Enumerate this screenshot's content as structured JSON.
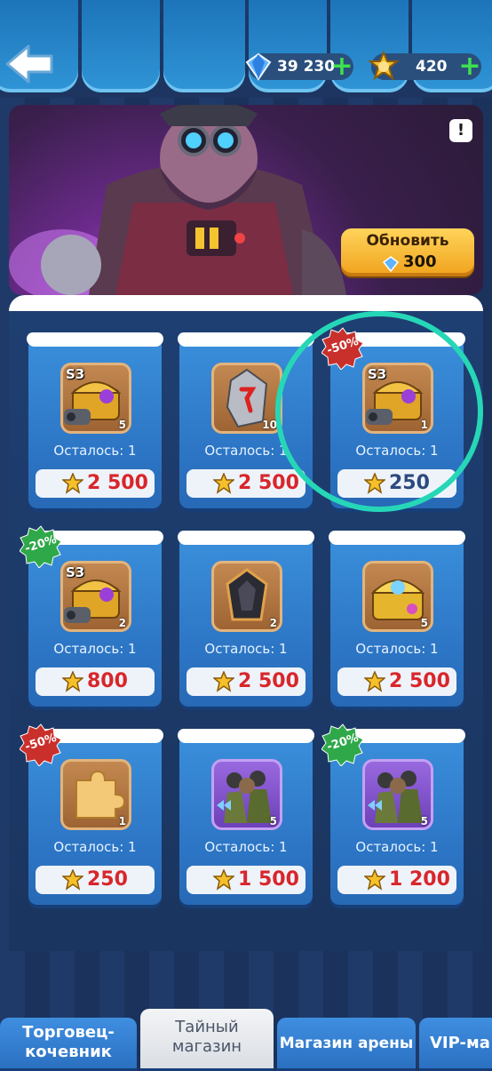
{
  "header": {
    "gems": "39 230",
    "stars": "420"
  },
  "banner": {
    "info_label": "!",
    "refresh_label": "Обновить",
    "refresh_cost": "300"
  },
  "shop": {
    "items": [
      {
        "remaining": "Осталось: 1",
        "price": "2 500",
        "qty": "5",
        "badge": "S3",
        "discount": "",
        "icon": "chest-s3-icon"
      },
      {
        "remaining": "Осталось: 1",
        "price": "2 500",
        "qty": "10",
        "badge": "",
        "discount": "",
        "icon": "rune-stone-icon"
      },
      {
        "remaining": "Осталось: 1",
        "price": "250",
        "qty": "1",
        "badge": "S3",
        "discount": "-50%",
        "icon": "chest-s3-icon"
      },
      {
        "remaining": "Осталось: 1",
        "price": "800",
        "qty": "2",
        "badge": "S3",
        "discount": "-20%",
        "icon": "chest-s3-icon"
      },
      {
        "remaining": "Осталось: 1",
        "price": "2 500",
        "qty": "2",
        "badge": "",
        "discount": "",
        "icon": "dark-crystal-icon"
      },
      {
        "remaining": "Осталось: 1",
        "price": "2 500",
        "qty": "5",
        "badge": "",
        "discount": "",
        "icon": "gold-chest-icon"
      },
      {
        "remaining": "Осталось: 1",
        "price": "250",
        "qty": "1",
        "badge": "",
        "discount": "-50%",
        "icon": "puzzle-piece-icon"
      },
      {
        "remaining": "Осталось: 1",
        "price": "1 500",
        "qty": "5",
        "badge": "",
        "discount": "",
        "icon": "soldiers-card-icon"
      },
      {
        "remaining": "Осталось: 1",
        "price": "1 200",
        "qty": "5",
        "badge": "",
        "discount": "-20%",
        "icon": "soldiers-card-icon"
      }
    ]
  },
  "tabs": [
    {
      "label": "Торговец-кочевник"
    },
    {
      "label": "Тайный магазин"
    },
    {
      "label": "Магазин арены"
    },
    {
      "label": "VIP-ма"
    }
  ],
  "colors": {
    "price_red": "#d8262b",
    "price_blue": "#2c4a7e",
    "highlight_ring": "#26d7b7",
    "discount_red": "#c9302c",
    "discount_green": "#2fa84a"
  }
}
